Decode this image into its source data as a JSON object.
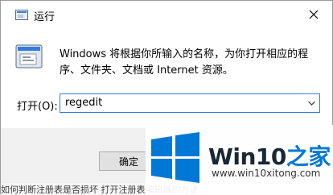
{
  "window": {
    "title": "运行",
    "close_icon": "close-icon"
  },
  "content": {
    "description": "Windows 将根据你所输入的名称，为你打开相应的程序、文件夹、文档或 Internet 资源。",
    "open_label": "打开(O):",
    "command_value": "regedit"
  },
  "buttons": {
    "ok_label": "确定"
  },
  "footer": {
    "partial_text": "如何判断注册表是否损坏 打开注册表编辑器的方法"
  },
  "watermark": {
    "brand_main": "Win10",
    "brand_accent": "之家",
    "url": "www.win10xitong.com"
  },
  "colors": {
    "accent": "#2f7de1",
    "logo_blue": "#0078d7"
  }
}
